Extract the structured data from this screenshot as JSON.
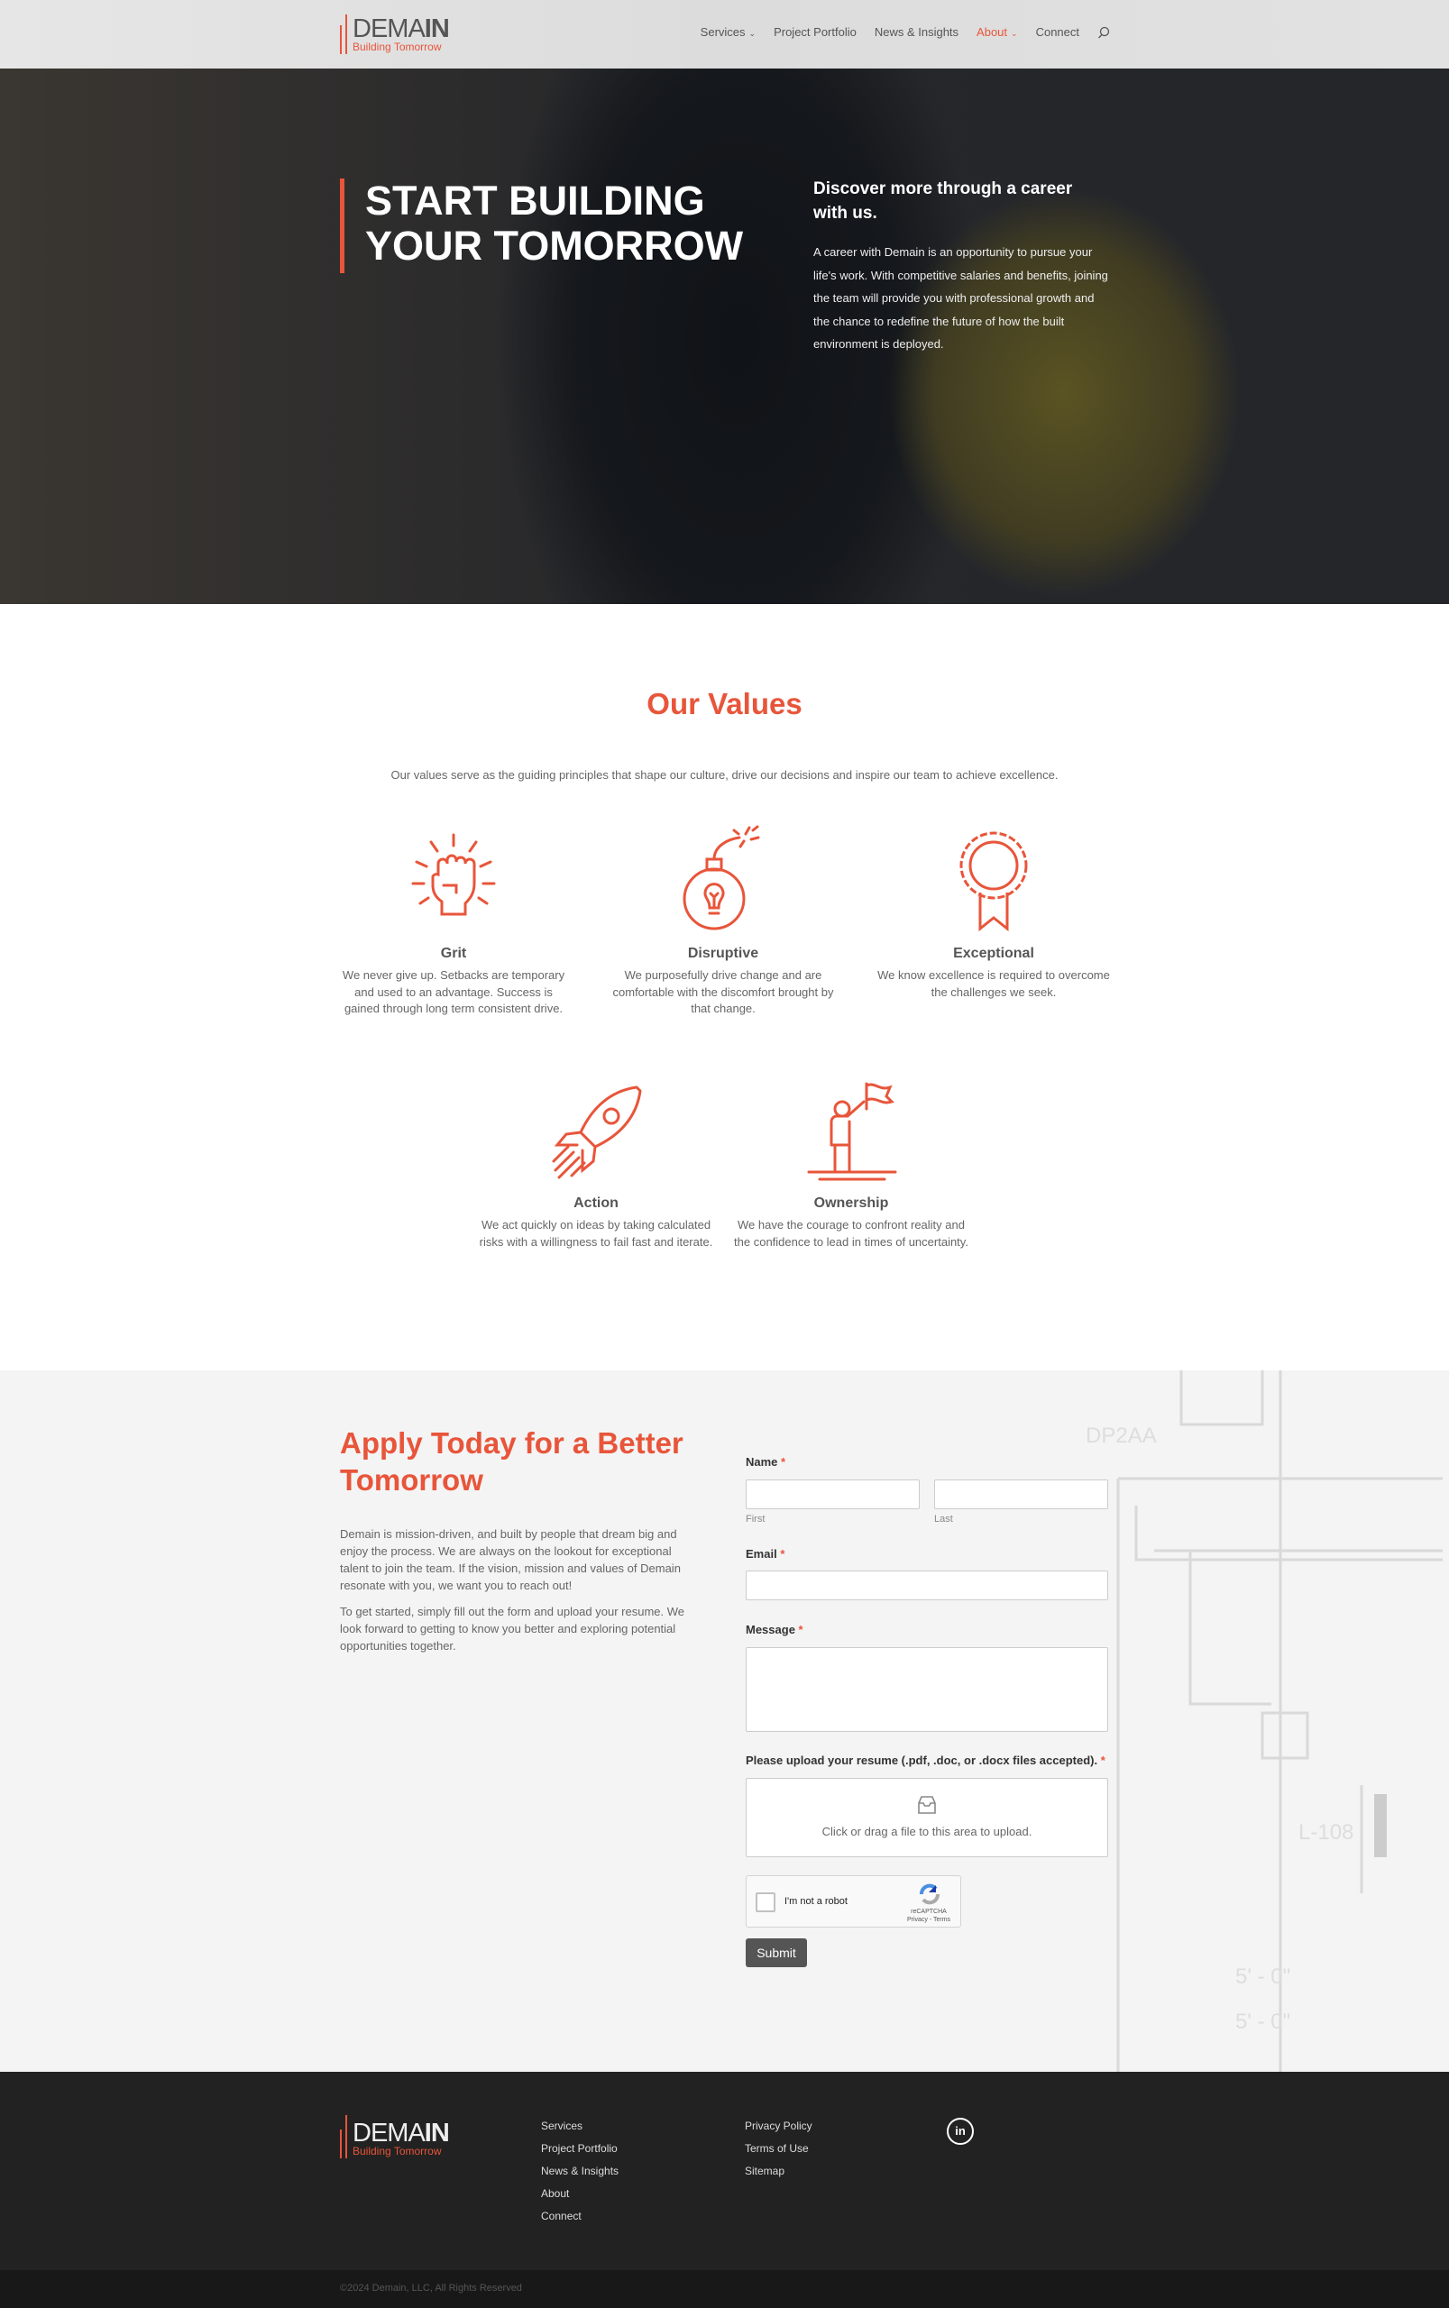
{
  "brand": {
    "name_light": "DEMA",
    "name_bold": "IN",
    "tagline": "Building Tomorrow",
    "accent": "#e8553a"
  },
  "nav": {
    "items": [
      {
        "label": "Services",
        "dropdown": true
      },
      {
        "label": "Project Portfolio"
      },
      {
        "label": "News & Insights"
      },
      {
        "label": "About",
        "dropdown": true,
        "active": true
      },
      {
        "label": "Connect"
      }
    ],
    "search_icon": "search-icon"
  },
  "hero": {
    "title_line1": "START BUILDING",
    "title_line2": "YOUR TOMORROW",
    "subtitle": "Discover more through a career with us.",
    "body": "A career with Demain is an opportunity to pursue your life's work. With competitive salaries and benefits, joining the team will provide you with professional growth and the chance to redefine the future of how the built environment is deployed."
  },
  "values": {
    "title": "Our Values",
    "subtitle": "Our values serve as the guiding principles that shape our culture, drive our decisions and inspire our team to achieve excellence.",
    "items": [
      {
        "title": "Grit",
        "icon": "fist-icon",
        "text": "We never give up. Setbacks are temporary and used to an advantage. Success is gained through long term consistent drive."
      },
      {
        "title": "Disruptive",
        "icon": "lightbulb-bomb-icon",
        "text": "We purposefully drive change and are comfortable with the discomfort brought by that change."
      },
      {
        "title": "Exceptional",
        "icon": "award-ribbon-icon",
        "text": "We know excellence is required to overcome the challenges we seek."
      },
      {
        "title": "Action",
        "icon": "rocket-icon",
        "text": "We act quickly on ideas by taking calculated risks with a willingness to fail fast and iterate."
      },
      {
        "title": "Ownership",
        "icon": "person-flag-icon",
        "text": "We have the courage to confront reality and the confidence to lead in times of uncertainty."
      }
    ]
  },
  "apply": {
    "title": "Apply Today for a Better Tomorrow",
    "para1": "Demain is mission-driven, and built by people that dream big and enjoy the process. We are always on the lookout for exceptional talent to join the team. If the vision, mission and values of Demain resonate with you, we want you to reach out!",
    "para2": "To get started, simply fill out the form and upload your resume. We look forward to getting to know you better and exploring potential opportunities together.",
    "form": {
      "name_label": "Name",
      "first_sub": "First",
      "last_sub": "Last",
      "first_value": "",
      "last_value": "",
      "email_label": "Email",
      "email_value": "",
      "message_label": "Message",
      "message_value": "",
      "upload_label": "Please upload your resume (.pdf, .doc, or .docx files accepted).",
      "upload_hint": "Click or drag a file to this area to upload.",
      "required_mark": "*",
      "captcha_label": "I'm not a robot",
      "captcha_brand": "reCAPTCHA",
      "captcha_links": "Privacy - Terms",
      "submit": "Submit"
    }
  },
  "footer": {
    "col1": [
      "Services",
      "Project Portfolio",
      "News & Insights",
      "About",
      "Connect"
    ],
    "col2": [
      "Privacy Policy",
      "Terms of Use",
      "Sitemap"
    ],
    "social": "linkedin-icon",
    "social_label": "in",
    "copyright": "©2024 Demain, LLC, All Rights Reserved"
  }
}
